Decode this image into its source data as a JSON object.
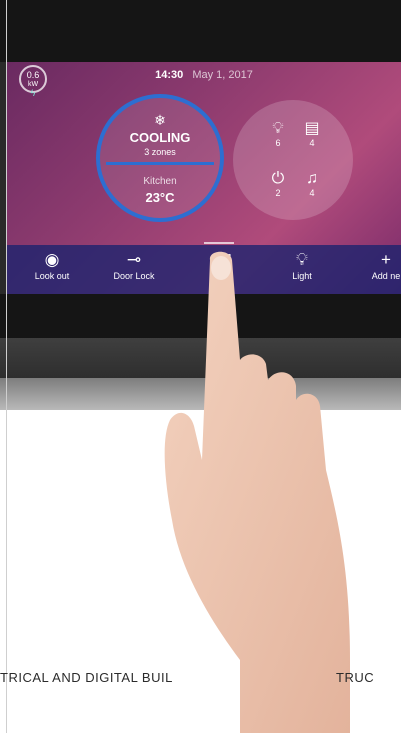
{
  "status": {
    "power_value": "0.6",
    "power_unit": "kW",
    "time": "14:30",
    "date": "May 1, 2017"
  },
  "climate": {
    "mode": "COOLING",
    "zones": "3 zones",
    "room": "Kitchen",
    "temperature": "23°C"
  },
  "devices": [
    {
      "icon": "lightbulb-icon",
      "count": "6"
    },
    {
      "icon": "shutter-icon",
      "count": "4"
    },
    {
      "icon": "plug-icon",
      "count": "2"
    },
    {
      "icon": "music-icon",
      "count": "4"
    }
  ],
  "tabs": [
    {
      "icon": "eye-icon",
      "label": "Look out"
    },
    {
      "icon": "key-icon",
      "label": "Door Lock"
    },
    {
      "icon": "shutter-icon",
      "label": ""
    },
    {
      "icon": "lightbulb-icon",
      "label": "Light"
    },
    {
      "icon": "plus-icon",
      "label": "Add ne"
    }
  ],
  "caption": {
    "left": "TRICAL AND DIGITAL BUIL",
    "right": "TRUC"
  },
  "colors": {
    "accent": "#2d6ed1",
    "screen_purple": "#8b3a6e",
    "tabbar": "#1d2a74"
  }
}
